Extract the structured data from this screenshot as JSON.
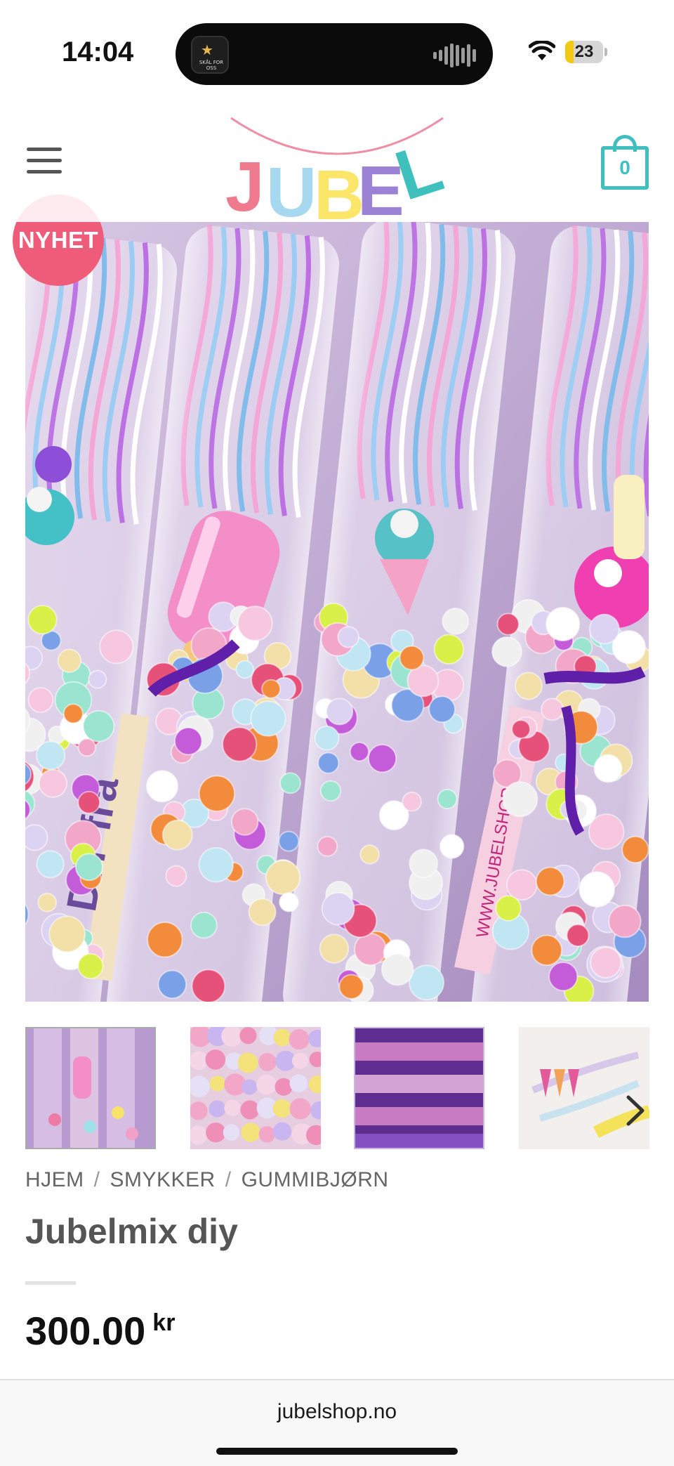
{
  "status_bar": {
    "time": "14:04",
    "battery_level": "23",
    "battery_fraction": 0.23,
    "island_app_caption": "SKÅL FOR OSS"
  },
  "header": {
    "logo_text": "JUBEL",
    "cart_count": "0",
    "menu_icon": "hamburger-icon",
    "cart_icon": "shopping-bag-icon"
  },
  "hero": {
    "badge": "NYHET",
    "image_label_text": "DIY fra",
    "image_side_text": "WWW.JUBELSHOP.NO"
  },
  "thumbnails": [
    {
      "name": "thumb-bead-tubes"
    },
    {
      "name": "thumb-glitter-beads"
    },
    {
      "name": "thumb-tube-rows"
    },
    {
      "name": "thumb-bracelets"
    }
  ],
  "breadcrumb": {
    "items": [
      "HJEM",
      "SMYKKER",
      "GUMMIBJØRN"
    ],
    "separator": "/"
  },
  "product": {
    "title": "Jubelmix diy",
    "price": "300.00",
    "currency": "kr"
  },
  "browser": {
    "url": "jubelshop.no"
  },
  "colors": {
    "accent_teal": "#3fbfbf",
    "badge_pink": "#ef5c7a",
    "battery_yellow": "#f2c811"
  }
}
